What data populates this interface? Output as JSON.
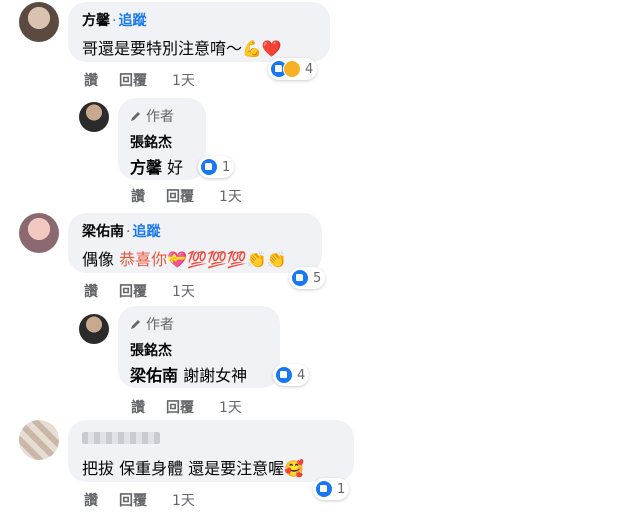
{
  "labels": {
    "follow": "追蹤",
    "dot": "·",
    "like": "讚",
    "reply": "回覆",
    "author": "作者"
  },
  "comments": [
    {
      "name": "方馨",
      "text": "哥還是要特別注意唷～💪❤️",
      "time": "1天",
      "reaction_count": "4",
      "reply": {
        "name": "張銘杰",
        "tag": "方馨",
        "text": "好",
        "time": "1天",
        "reaction_count": "1"
      }
    },
    {
      "name": "梁佑南",
      "text_plain": "偶像",
      "text_highlight": "恭喜你",
      "text_emoji": "💝💯💯💯👏👏",
      "time": "1天",
      "reaction_count": "5",
      "reply": {
        "name": "張銘杰",
        "tag": "梁佑南",
        "text": "謝謝女神",
        "time": "1天",
        "reaction_count": "4"
      }
    },
    {
      "name": "",
      "text": "把拔 保重身體 還是要注意喔🥰",
      "time": "1天",
      "reaction_count": "1"
    }
  ],
  "colors": {
    "link": "#1877f2",
    "bubble": "#f0f2f5",
    "meta": "#65676b",
    "highlight": "#e9573f"
  }
}
